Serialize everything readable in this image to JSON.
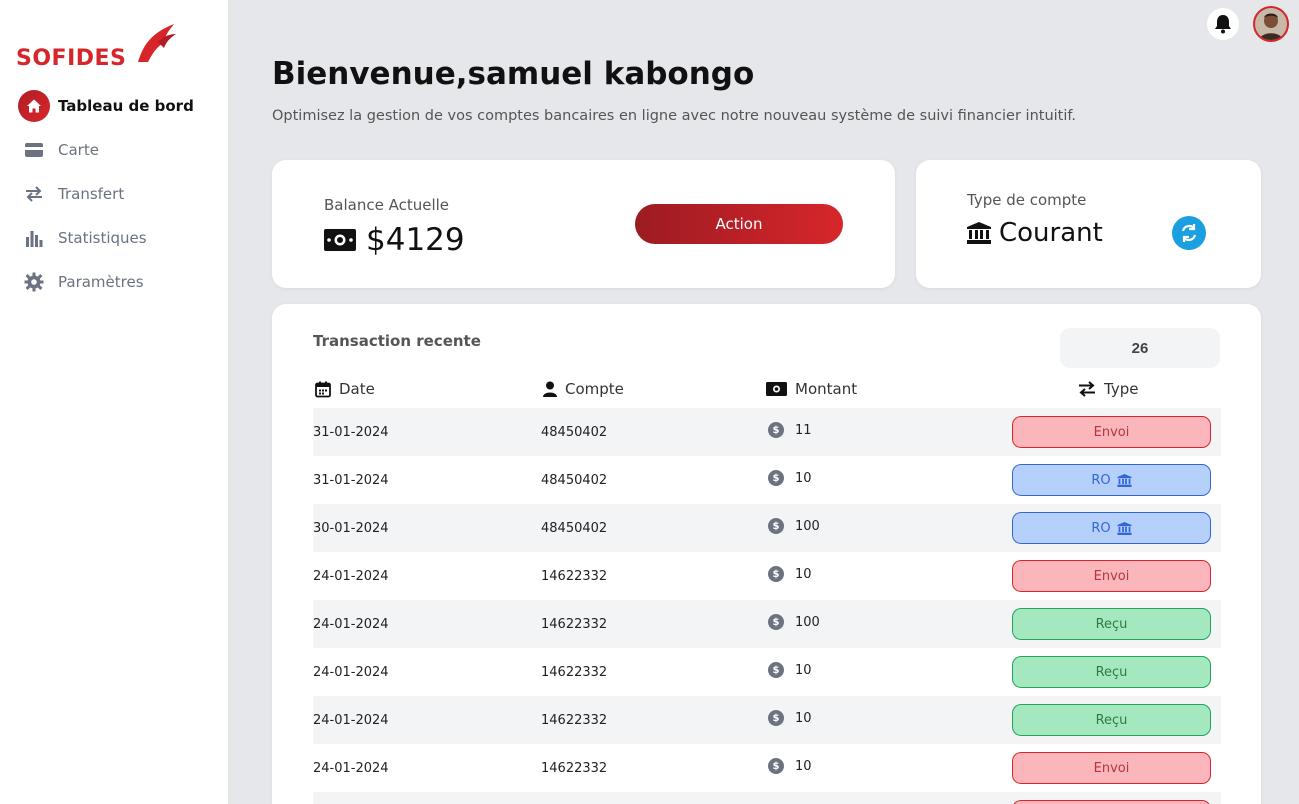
{
  "brand": {
    "name": "SOFIDES",
    "color": "#d7262b"
  },
  "sidebar": {
    "items": [
      {
        "label": "Tableau de bord",
        "icon": "home-icon",
        "active": true
      },
      {
        "label": "Carte",
        "icon": "card-icon",
        "active": false
      },
      {
        "label": "Transfert",
        "icon": "transfer-icon",
        "active": false
      },
      {
        "label": "Statistiques",
        "icon": "chart-icon",
        "active": false
      },
      {
        "label": "Paramètres",
        "icon": "gear-icon",
        "active": false
      }
    ]
  },
  "topbar": {
    "bell_icon": "bell-icon",
    "avatar_icon": "avatar"
  },
  "header": {
    "title": "Bienvenue,samuel kabongo",
    "subtitle": "Optimisez la gestion de vos comptes bancaires en ligne avec notre nouveau système de suivi financier intuitif."
  },
  "balance": {
    "label": "Balance Actuelle",
    "value": "$4129",
    "action_label": "Action"
  },
  "account_type": {
    "label": "Type de compte",
    "value": "Courant"
  },
  "transactions": {
    "title": "Transaction recente",
    "count": "26",
    "columns": {
      "date": "Date",
      "account": "Compte",
      "amount": "Montant",
      "type": "Type"
    },
    "rows": [
      {
        "date": "31-01-2024",
        "account": "48450402",
        "amount": "11",
        "type": "Envoi",
        "kind": "envoi"
      },
      {
        "date": "31-01-2024",
        "account": "48450402",
        "amount": "10",
        "type": "RO",
        "kind": "ro"
      },
      {
        "date": "30-01-2024",
        "account": "48450402",
        "amount": "100",
        "type": "RO",
        "kind": "ro"
      },
      {
        "date": "24-01-2024",
        "account": "14622332",
        "amount": "10",
        "type": "Envoi",
        "kind": "envoi"
      },
      {
        "date": "24-01-2024",
        "account": "14622332",
        "amount": "100",
        "type": "Reçu",
        "kind": "recu"
      },
      {
        "date": "24-01-2024",
        "account": "14622332",
        "amount": "10",
        "type": "Reçu",
        "kind": "recu"
      },
      {
        "date": "24-01-2024",
        "account": "14622332",
        "amount": "10",
        "type": "Reçu",
        "kind": "recu"
      },
      {
        "date": "24-01-2024",
        "account": "14622332",
        "amount": "10",
        "type": "Envoi",
        "kind": "envoi"
      },
      {
        "date": "",
        "account": "",
        "amount": "",
        "type": "",
        "kind": "envoi"
      }
    ]
  }
}
